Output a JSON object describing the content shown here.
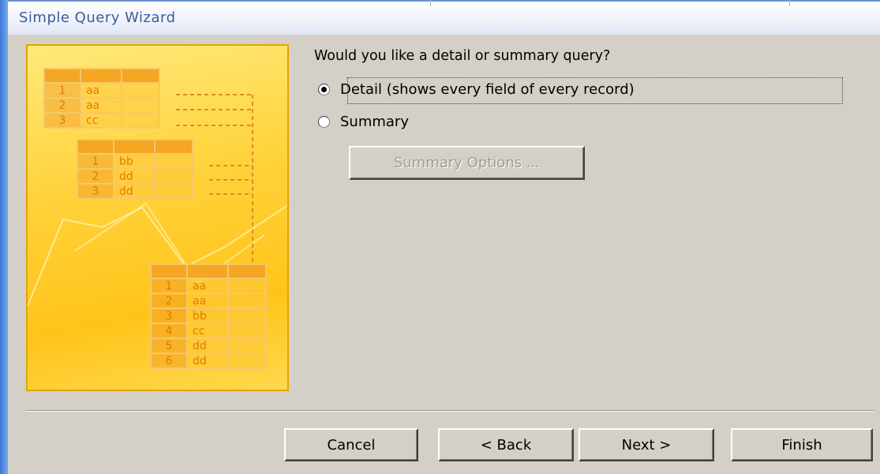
{
  "window": {
    "title": "Simple Query Wizard"
  },
  "illustration": {
    "table1": [
      [
        "1",
        "aa"
      ],
      [
        "2",
        "aa"
      ],
      [
        "3",
        "cc"
      ]
    ],
    "table2": [
      [
        "1",
        "bb"
      ],
      [
        "2",
        "dd"
      ],
      [
        "3",
        "dd"
      ]
    ],
    "table3": [
      [
        "1",
        "aa"
      ],
      [
        "2",
        "aa"
      ],
      [
        "3",
        "bb"
      ],
      [
        "4",
        "cc"
      ],
      [
        "5",
        "dd"
      ],
      [
        "6",
        "dd"
      ]
    ]
  },
  "question": "Would you like a detail or summary query?",
  "options": {
    "detail": {
      "label": "Detail (shows every field of every record)",
      "selected": true
    },
    "summary": {
      "label": "Summary",
      "selected": false
    }
  },
  "summary_options_label": "Summary Options ...",
  "buttons": {
    "cancel": "Cancel",
    "back": "< Back",
    "next": "Next >",
    "finish": "Finish"
  },
  "colors": {
    "accent": "#3a78d8",
    "dialog": "#d4d0c8",
    "illustration": "#ffd23a"
  }
}
